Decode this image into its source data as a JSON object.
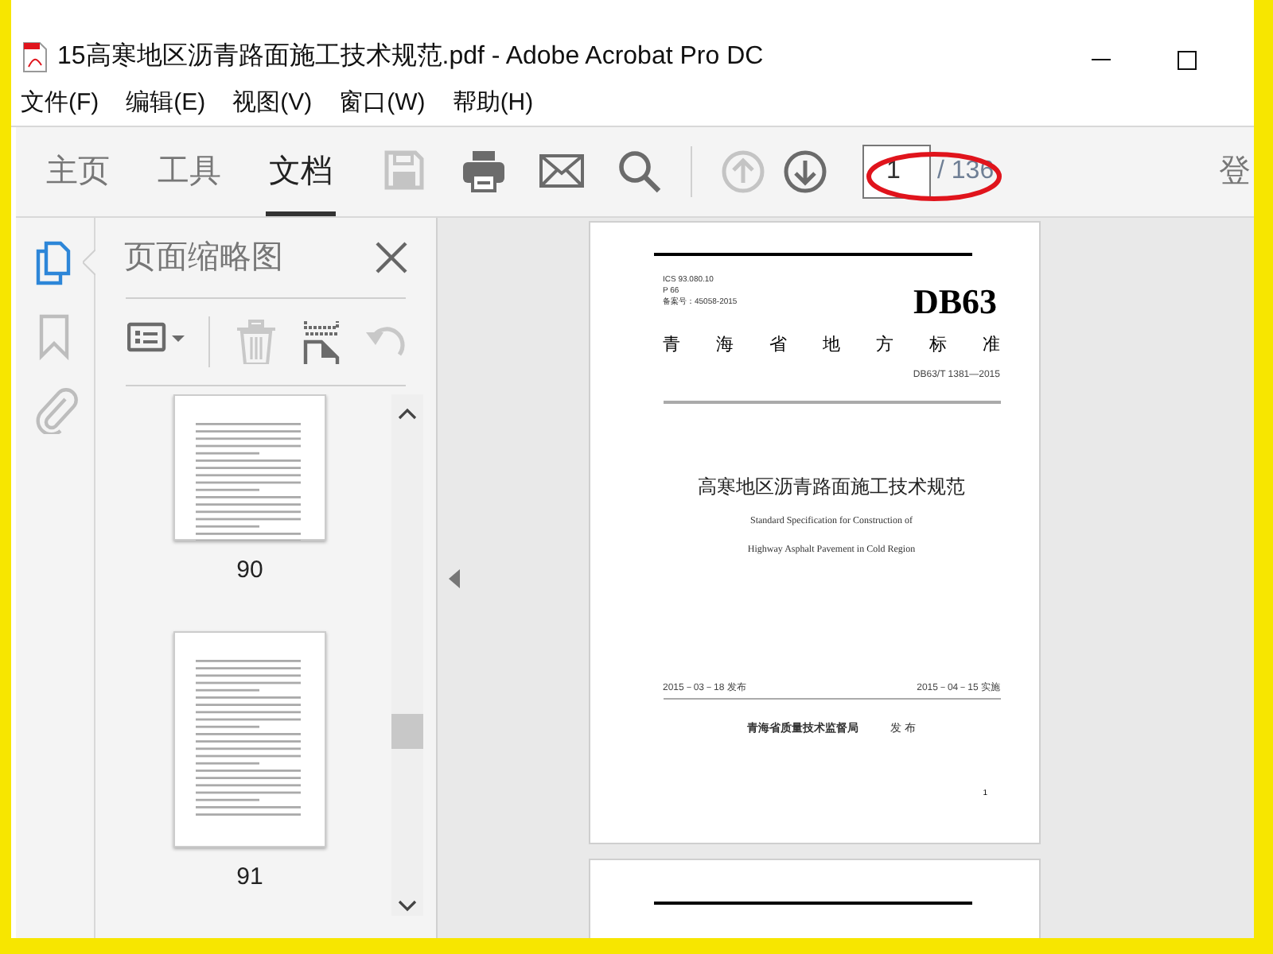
{
  "window": {
    "title": "15高寒地区沥青路面施工技术规范.pdf - Adobe Acrobat Pro DC"
  },
  "menu": [
    "文件(F)",
    "编辑(E)",
    "视图(V)",
    "窗口(W)",
    "帮助(H)"
  ],
  "tabs": [
    {
      "label": "主页",
      "selected": false
    },
    {
      "label": "工具",
      "selected": false
    },
    {
      "label": "文档",
      "selected": true
    }
  ],
  "toolbar": {
    "tools": [
      {
        "kind": "save",
        "disabled": true
      },
      {
        "kind": "print",
        "disabled": false
      },
      {
        "kind": "mail",
        "disabled": false
      },
      {
        "kind": "search",
        "disabled": false
      }
    ],
    "nav": [
      {
        "kind": "prev",
        "disabled": true
      },
      {
        "kind": "next",
        "disabled": false
      }
    ],
    "page_field": {
      "value": "1"
    },
    "page_total": "/ 136",
    "sign_in": "登"
  },
  "side_icons": [
    {
      "kind": "pages",
      "selected": true
    },
    {
      "kind": "bookmark",
      "selected": false
    },
    {
      "kind": "attachment",
      "selected": false
    }
  ],
  "panel": {
    "title": "页面缩略图",
    "tools": [
      {
        "kind": "options",
        "disabled": false
      },
      {
        "kind": "delete",
        "disabled": true
      },
      {
        "kind": "insert",
        "disabled": false
      },
      {
        "kind": "rotate",
        "disabled": true
      }
    ],
    "thumbnails": [
      {
        "label": "90"
      },
      {
        "label": "91"
      }
    ]
  },
  "document": {
    "meta": [
      "ICS 93.080.10",
      "P 66",
      "备案号：45058-2015"
    ],
    "logo": "DB63",
    "standard_type": "青 海 省 地 方 标 准",
    "code": "DB63/T 1381—2015",
    "title": "高寒地区沥青路面施工技术规范",
    "subtitle": [
      "Standard Specification for Construction of",
      "Highway Asphalt Pavement in Cold Region"
    ],
    "issue_date": "2015－03－18 发布",
    "effective_date": "2015－04－15 实施",
    "issuer": "青海省质量技术监督局",
    "issuer_action": "发 布",
    "page_number": "1"
  }
}
